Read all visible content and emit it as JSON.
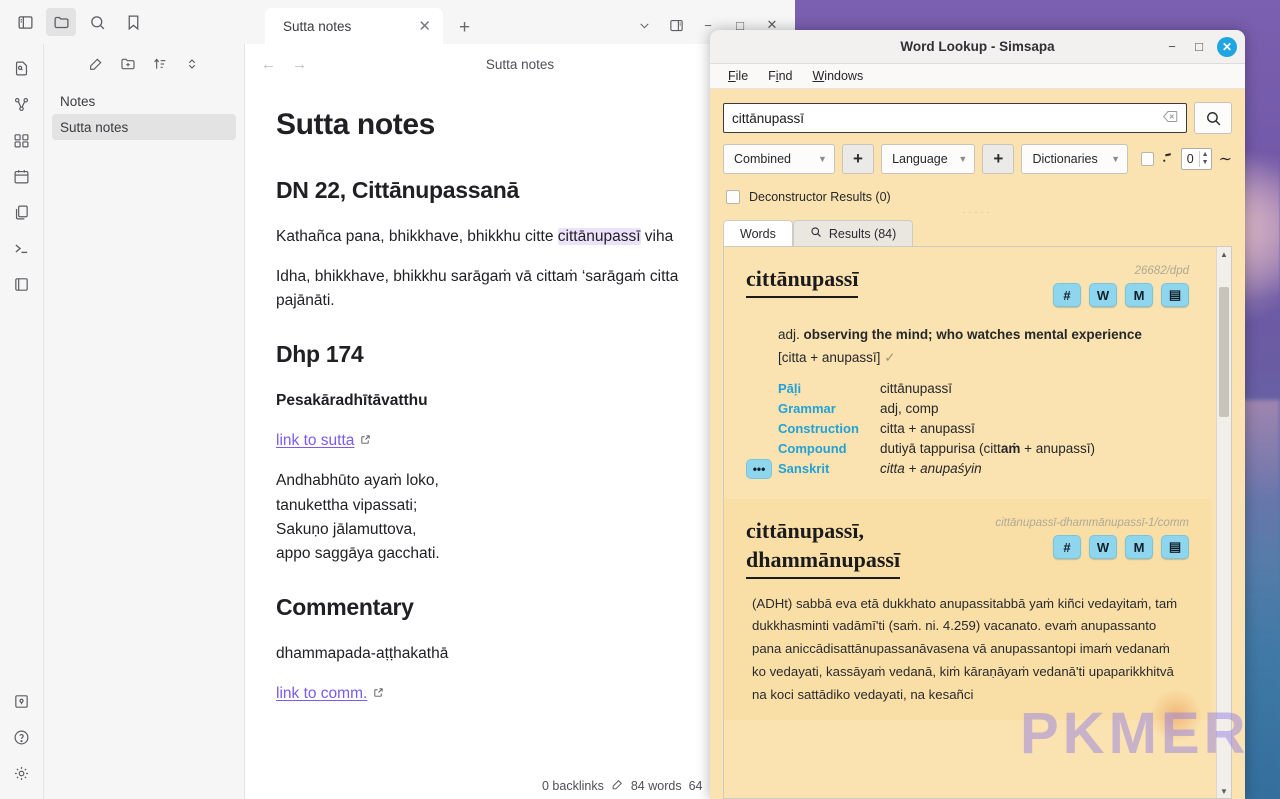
{
  "desktop": {
    "watermark": "PKMER"
  },
  "obsidian": {
    "ribbon_top": [
      {
        "name": "toggle-left-sidebar-icon",
        "label": "sidebar"
      },
      {
        "name": "folder-icon",
        "label": "files"
      },
      {
        "name": "search-icon",
        "label": "search"
      },
      {
        "name": "bookmark-icon",
        "label": "bookmarks"
      }
    ],
    "tab": {
      "title": "Sutta notes",
      "close": "✕",
      "new_tab": "+"
    },
    "window_controls": {
      "chevron": "⌄",
      "split": "split",
      "minimize": "−",
      "maximize": "□",
      "close": "✕"
    },
    "ribbon_left": [
      {
        "name": "quick-switcher-icon"
      },
      {
        "name": "graph-view-icon"
      },
      {
        "name": "canvas-icon"
      },
      {
        "name": "daily-note-icon"
      },
      {
        "name": "templates-icon"
      },
      {
        "name": "terminal-icon"
      },
      {
        "name": "reading-view-icon"
      }
    ],
    "ribbon_left_bottom": [
      {
        "name": "vault-icon"
      },
      {
        "name": "help-icon"
      },
      {
        "name": "settings-icon"
      }
    ],
    "filepane": {
      "toolbar": [
        "new-note-icon",
        "new-folder-icon",
        "sort-icon",
        "collapse-icon"
      ],
      "items": [
        {
          "label": "Notes",
          "selected": false
        },
        {
          "label": "Sutta notes",
          "selected": true
        }
      ]
    },
    "view_header": {
      "title": "Sutta notes",
      "back": "←",
      "forward": "→"
    },
    "note": {
      "h1": "Sutta notes",
      "h2_dn": "DN 22, Cittānupassanā",
      "para1_pre": "Kathañca pana, bhikkhave, bhikkhu citte ",
      "para1_hl": "cittānupassī",
      "para1_post": " viha",
      "para2": "Idha, bhikkhave, bhikkhu sarāgaṁ vā cittaṁ ‘sarāgaṁ citta\npajānāti.",
      "h2_dhp": "Dhp 174",
      "bold_line": "Pesakāradhītāvatthu",
      "link_sutta": "link to sutta",
      "verse": "Andhabhūto ayaṁ loko,\ntanukettha vipassati;\nSakuṇo jālamuttova,\nappo saggāya gacchati.",
      "h2_comm": "Commentary",
      "comm_line": "dhammapada-aṭṭhakathā",
      "link_comm": "link to comm."
    },
    "status": {
      "backlinks": "0 backlinks",
      "edit_icon": "pencil-icon",
      "words": "84 words",
      "chars": "64"
    }
  },
  "simsapa": {
    "title": "Word Lookup - Simsapa",
    "window_controls": {
      "minimize": "−",
      "maximize": "□",
      "close": "✕"
    },
    "menu": [
      {
        "label": "File",
        "accel": "F"
      },
      {
        "label": "Find",
        "accel": "i"
      },
      {
        "label": "Windows",
        "accel": "W"
      }
    ],
    "search": {
      "value": "cittānupassī",
      "placeholder": "",
      "clear_icon": "clear-icon",
      "search_icon": "search-icon"
    },
    "controls": {
      "combined": "Combined",
      "plus1": "+",
      "language": "Language",
      "plus2": "+",
      "dictionaries": "Dictionaries",
      "checkbox_checked": false,
      "spin_value": "0",
      "tilde": "∼"
    },
    "deconstructor": {
      "label": "Deconstructor Results (0)",
      "checked": false
    },
    "tabs": [
      {
        "label": "Words",
        "active": true,
        "icon": null
      },
      {
        "label": "Results (84)",
        "active": false,
        "icon": "search-icon"
      }
    ],
    "entries": [
      {
        "word": "cittānupassī",
        "id": "26682/dpd",
        "buttons": [
          "#",
          "W",
          "M",
          "▤"
        ],
        "pos": "adj.",
        "definition": "observing the mind; who watches mental experience",
        "bracket": "[citta + anupassī]",
        "check": "✓",
        "fields": [
          {
            "key": "Pāḷi",
            "value": "cittānupassī",
            "italic": false,
            "dots": false
          },
          {
            "key": "Grammar",
            "value": "adj, comp",
            "italic": false,
            "dots": false
          },
          {
            "key": "Construction",
            "value": "citta + anupassī",
            "italic": false,
            "dots": false
          },
          {
            "key": "Compound",
            "value": "dutiyā tappurisa (cittaṁ + anupassī)",
            "italic": false,
            "dots": false
          },
          {
            "key": "Sanskrit",
            "value": "citta + anupaśyin",
            "italic": true,
            "dots": true
          }
        ]
      },
      {
        "word": "cittānupassī,\ndhammānupassī",
        "id": "cittānupassī-dhammānupassī-1/comm",
        "buttons": [
          "#",
          "W",
          "M",
          "▤"
        ],
        "commentary": "(ADHt) sabbā eva etā dukkhato anupassitabbā yaṁ kiñci vedayitaṁ, taṁ dukkhasminti vadāmī'ti (saṁ. ni. 4.259) vacanato. evaṁ anupassanto pana aniccādisattānupassanāvasena vā anupassantopi imaṁ vedanaṁ ko vedayati, kassāyaṁ vedanā, kiṁ kāraṇāyaṁ vedanā'ti upaparikkhitvā na koci sattādiko vedayati, na kesañci"
      }
    ]
  }
}
